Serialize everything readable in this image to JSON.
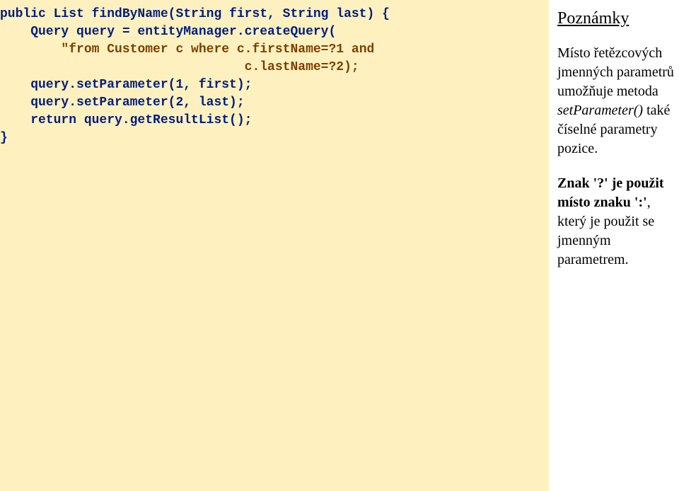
{
  "code": {
    "line1": "public List findByName(String first, String last) {",
    "line2a": "    Query query = entityManager.createQuery(",
    "line2b": "",
    "line3a": "        ",
    "line3b": "\"from Customer c where c.firstName=?1 and",
    "line4": "                                c.lastName=?2);",
    "line5": "    query.setParameter(1, first);",
    "line6": "    query.setParameter(2, last);",
    "line7": "    return query.getResultList();",
    "line8": "}"
  },
  "notes": {
    "title": "Poznámky",
    "p1_a": "Místo řetězcových jmenných parametrů umožňuje metoda ",
    "p1_em": "setParameter()",
    "p1_b": " také číselné parametry pozice.",
    "p2_a": "Znak ",
    "p2_s1": "'?'",
    "p2_b": " je použit místo znaku ",
    "p2_s2": "':'",
    "p2_c": ", který je použit se jmenným parametrem."
  }
}
